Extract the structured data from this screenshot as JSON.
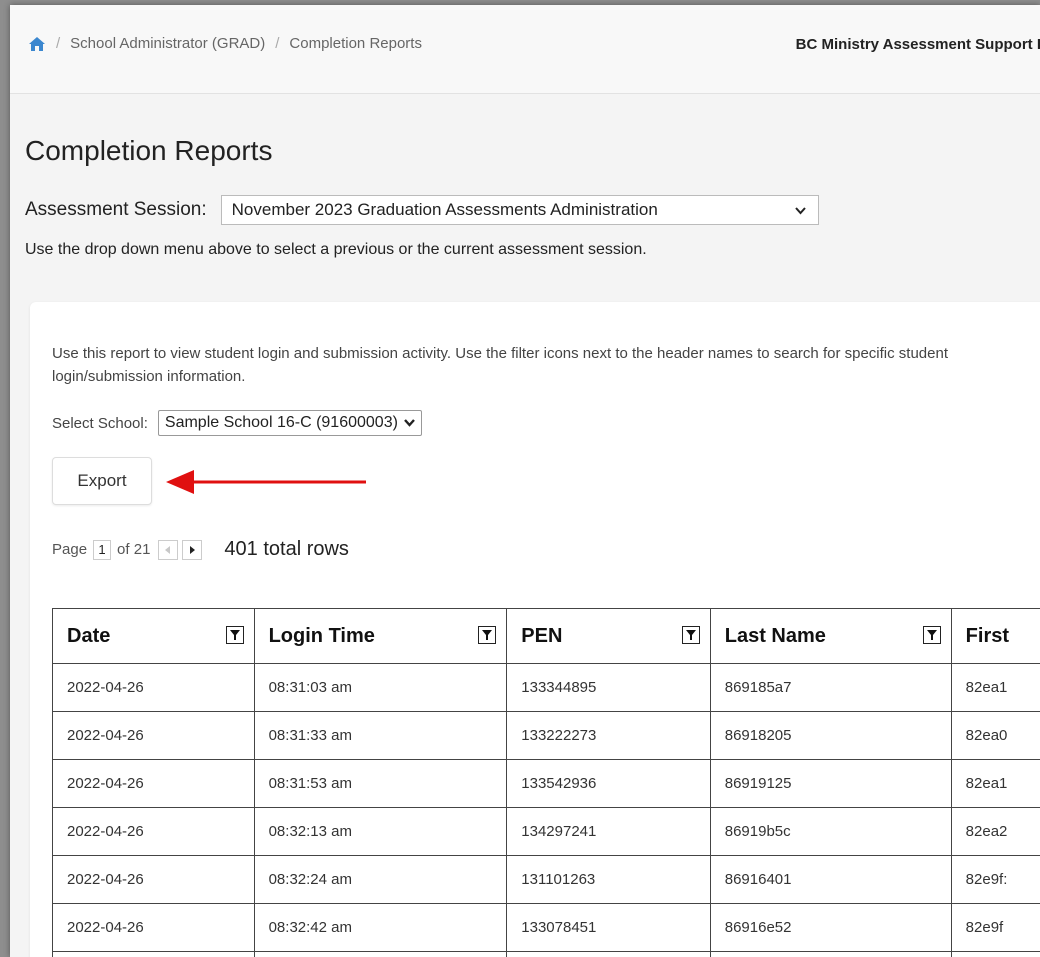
{
  "breadcrumb": {
    "items": [
      "School Administrator (GRAD)",
      "Completion Reports"
    ],
    "org": "BC Ministry Assessment Support L"
  },
  "page": {
    "title": "Completion Reports",
    "session_label": "Assessment Session:",
    "session_value": "November 2023 Graduation Assessments Administration",
    "session_help": "Use the drop down menu above to select a previous or the current assessment session."
  },
  "report": {
    "intro": "Use this report to view student login and submission activity. Use the filter icons next to the header names to search for specific student login/submission information.",
    "school_label": "Select School:",
    "school_value": "Sample School 16-C (91600003)",
    "export_label": "Export",
    "pager": {
      "page_label": "Page",
      "page": "1",
      "of_label": "of 21",
      "total": "401 total rows"
    },
    "columns": [
      "Date",
      "Login Time",
      "PEN",
      "Last Name",
      "First"
    ],
    "rows": [
      [
        "2022-04-26",
        "08:31:03 am",
        "133344895",
        "869185a7",
        "82ea1"
      ],
      [
        "2022-04-26",
        "08:31:33 am",
        "133222273",
        "86918205",
        "82ea0"
      ],
      [
        "2022-04-26",
        "08:31:53 am",
        "133542936",
        "86919125",
        "82ea1"
      ],
      [
        "2022-04-26",
        "08:32:13 am",
        "134297241",
        "86919b5c",
        "82ea2"
      ],
      [
        "2022-04-26",
        "08:32:24 am",
        "131101263",
        "86916401",
        "82e9f:"
      ],
      [
        "2022-04-26",
        "08:32:42 am",
        "133078451",
        "86916e52",
        "82e9f"
      ],
      [
        "",
        "",
        "",
        "",
        ""
      ]
    ]
  },
  "colors": {
    "home_icon": "#3b87cf",
    "arrow": "#e01010"
  }
}
